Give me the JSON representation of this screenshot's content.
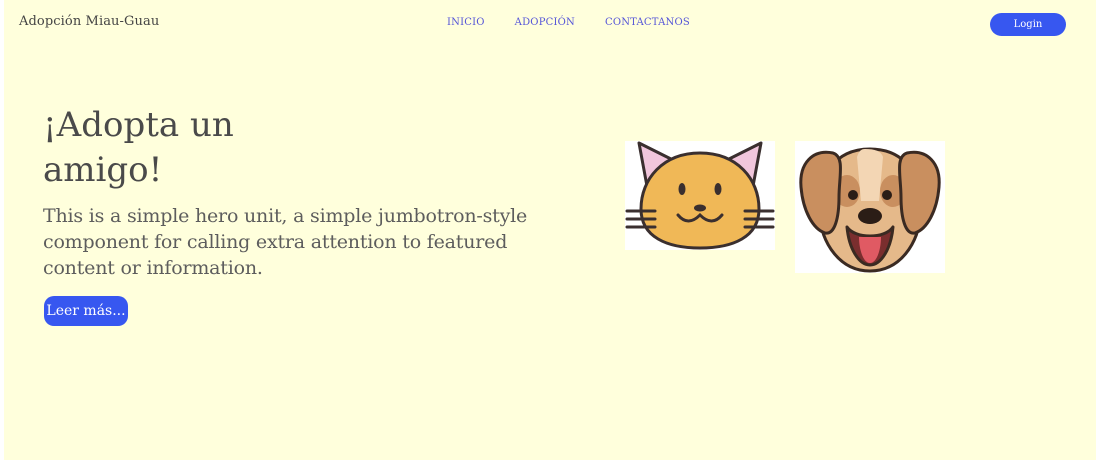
{
  "header": {
    "brand": "Adopción Miau-Guau",
    "nav": [
      {
        "label": "INICIO"
      },
      {
        "label": "ADOPCIÓN"
      },
      {
        "label": "CONTACTANOS"
      }
    ],
    "login_label": "Login"
  },
  "hero": {
    "title": "¡Adopta un amigo!",
    "lead": "This is a simple hero unit, a simple jumbotron-style component for calling extra attention to featured content or information.",
    "button_label": "Leer más..."
  },
  "images": [
    {
      "icon": "cat-face-icon"
    },
    {
      "icon": "dog-face-icon"
    }
  ],
  "colors": {
    "background": "#ffffdc",
    "accent": "#3757f0",
    "nav_link": "#5555d8"
  }
}
